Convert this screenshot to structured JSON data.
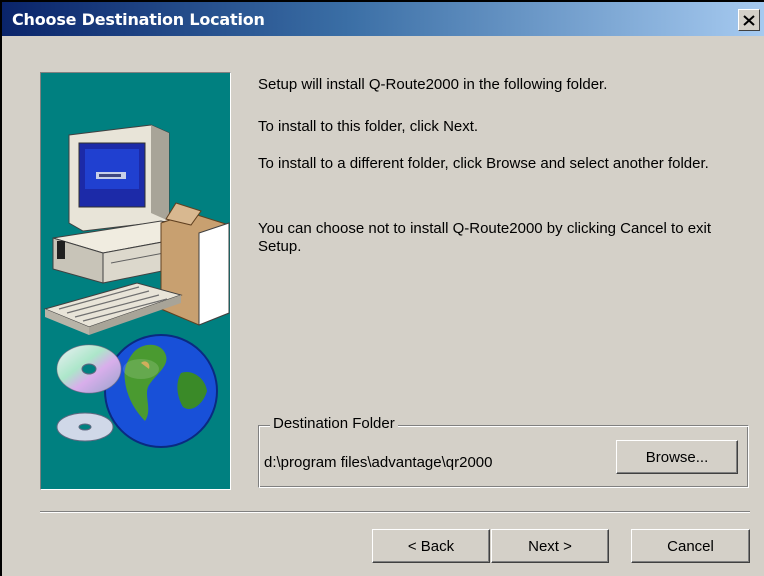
{
  "window": {
    "title": "Choose Destination Location",
    "close_glyph": "X"
  },
  "body": {
    "line1": "Setup will install Q-Route2000 in the following folder.",
    "line2": "To install to this folder, click Next.",
    "line3": "To install to a different folder, click Browse and select another folder.",
    "line4": "You can choose not to install Q-Route2000 by clicking Cancel to exit Setup."
  },
  "destination": {
    "legend": "Destination Folder",
    "path": "d:\\program files\\advantage\\qr2000",
    "browse_label": "Browse..."
  },
  "buttons": {
    "back_label": "< Back",
    "next_label": "Next >",
    "cancel_label": "Cancel"
  },
  "colors": {
    "title_bar": "#0a246a",
    "dialog_face": "#d4d0c8",
    "art_background": "#008080"
  },
  "icons": {
    "illustration": "computer-cd-globe-icon",
    "close": "close-icon"
  }
}
